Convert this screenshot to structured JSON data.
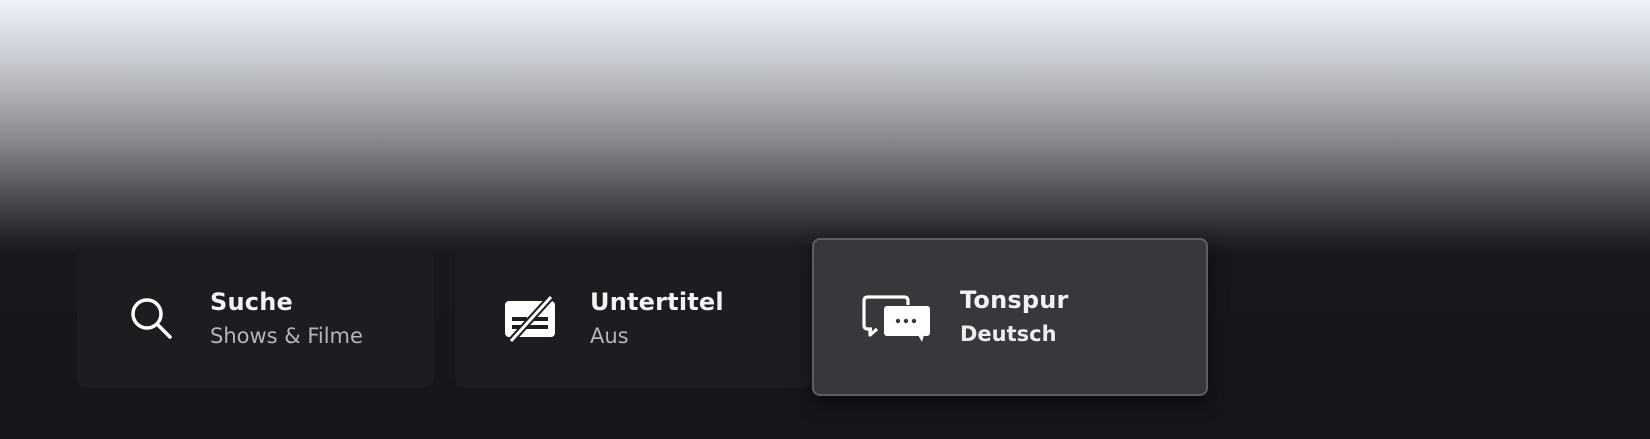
{
  "menu": {
    "items": [
      {
        "icon": "search-icon",
        "label": "Suche",
        "sublabel": "Shows & Filme"
      },
      {
        "icon": "subtitles-off-icon",
        "label": "Untertitel",
        "sublabel": "Aus"
      },
      {
        "icon": "audio-track-icon",
        "label": "Tonspur",
        "sublabel": "Deutsch",
        "focused": true
      }
    ]
  },
  "colors": {
    "tile_background": "#1c1d21",
    "focused_tile_background": "#37373c",
    "page_background": "#15161a",
    "title_text": "#f2f2f4",
    "subtitle_text": "#b4b5ba"
  }
}
